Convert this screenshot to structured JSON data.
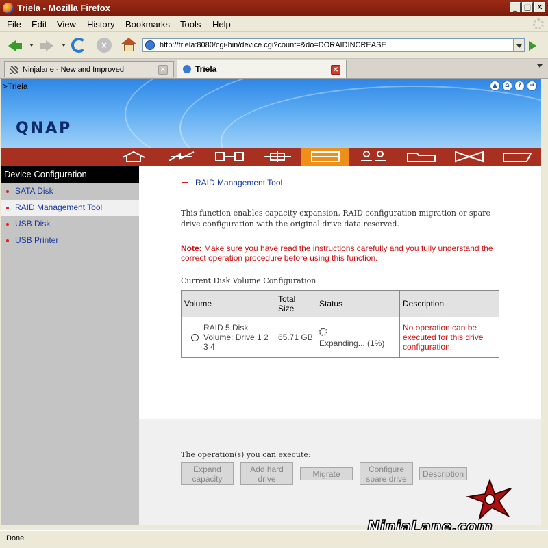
{
  "window": {
    "title": "Triela - Mozilla Firefox"
  },
  "menu": [
    "File",
    "Edit",
    "View",
    "History",
    "Bookmarks",
    "Tools",
    "Help"
  ],
  "address": {
    "url": "http://triela:8080/cgi-bin/device.cgi?count=&do=DORAIDINCREASE"
  },
  "tabs": [
    {
      "label": "Ninjalane - New and Improved"
    },
    {
      "label": "Triela"
    }
  ],
  "page": {
    "breadcrumb": ">Triela",
    "logo": "QNAP",
    "toolbar_icons": [
      "home-icon",
      "network-icon",
      "device-icon",
      "system-icon",
      "device-config-icon",
      "users-icon",
      "share-folder-icon",
      "network-service-icon",
      "statistics-icon"
    ],
    "sidebar": {
      "heading": "Device Configuration",
      "items": [
        {
          "label": "SATA Disk"
        },
        {
          "label": "RAID Management Tool"
        },
        {
          "label": "USB Disk"
        },
        {
          "label": "USB Printer"
        }
      ]
    },
    "main": {
      "section_title": "RAID Management Tool",
      "description": "This function enables capacity expansion, RAID configuration migration or spare drive configuration with the original drive data reserved.",
      "note_label": "Note:",
      "note_text": " Make sure you have read the instructions carefully and you fully understand the correct operation procedure before using this function.",
      "config_label": "Current Disk Volume Configuration",
      "table": {
        "headers": [
          "Volume",
          "Total Size",
          "Status",
          "Description"
        ],
        "rows": [
          {
            "volume": "RAID 5 Disk Volume: Drive 1 2 3 4",
            "size": "65.71 GB",
            "status": "Expanding... (1%)",
            "description": "No operation can be executed for this drive configuration."
          }
        ]
      },
      "ops_label": "The operation(s) you can execute:",
      "buttons": {
        "expand": "Expand capacity",
        "add": "Add hard drive",
        "migrate": "Migrate",
        "spare": "Configure spare drive",
        "description": "Description"
      }
    }
  },
  "watermark": {
    "text": "NinjaLane.com"
  },
  "status": {
    "text": "Done"
  },
  "colors": {
    "toolbar": "#a83020",
    "toolbar_selected": "#f08e1a",
    "note": "#d01010",
    "link": "#1a3aa0"
  }
}
